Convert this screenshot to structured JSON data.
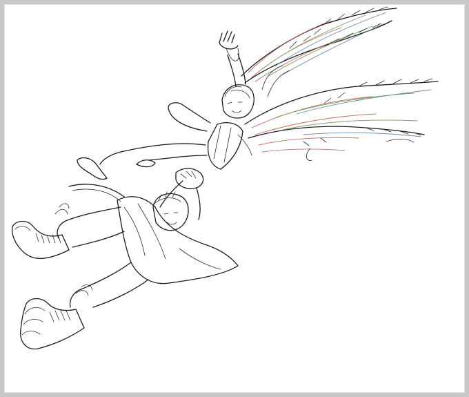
{
  "image": {
    "kind": "line-art illustration",
    "frame_color": "#c8c8c8",
    "background": "#ffffff",
    "ink_color": "#1a1a1a",
    "wing_tint_colors": [
      "#c46a5a",
      "#7a9a6a",
      "#6a8aa8",
      "#b07890"
    ]
  }
}
